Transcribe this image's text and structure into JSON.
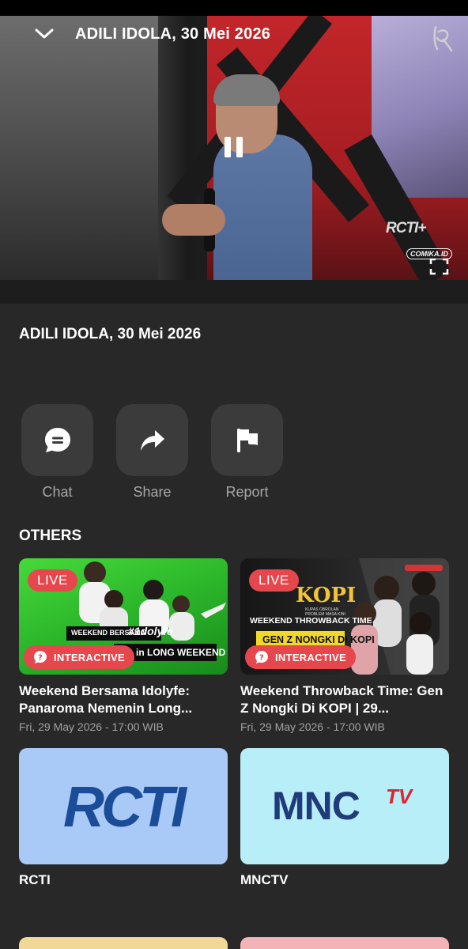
{
  "player": {
    "title": "ADILI IDOLA, 30 Mei 2026",
    "channel_bug": "RCTI+",
    "watermark": "COMIKA.ID"
  },
  "video": {
    "title": "ADILI IDOLA, 30 Mei 2026"
  },
  "actions": [
    {
      "label": "Chat",
      "icon": "chat-bubble-icon"
    },
    {
      "label": "Share",
      "icon": "share-arrow-icon"
    },
    {
      "label": "Report",
      "icon": "flag-icon"
    }
  ],
  "others": {
    "heading": "OTHERS",
    "items": [
      {
        "title": "Weekend Bersama Idolyfe: Panaroma Nemenin Long...",
        "date": "Fri, 29 May 2026 - 17:00 WIB",
        "live_label": "LIVE",
        "interactive_label": "INTERACTIVE",
        "thumb_text_top": "WEEKEND BERSAMA",
        "thumb_tag": "#1dolyfe",
        "thumb_text_bottom": "in LONG WEEKEND"
      },
      {
        "title": "Weekend Throwback Time: Gen Z Nongki Di KOPI | 29...",
        "date": "Fri, 29 May 2026 - 17:00 WIB",
        "live_label": "LIVE",
        "interactive_label": "INTERACTIVE",
        "thumb_brand": "KOPI",
        "thumb_brand_sub": "KUPAS OBROLAN PROBLEM MASA KINI",
        "thumb_text_top": "WEEKEND THROWBACK TIME",
        "thumb_text_bottom": "GEN Z NONGKI DI KOPI"
      }
    ]
  },
  "channels": [
    {
      "name": "RCTI",
      "logo_text": "RCTI",
      "bg": "#a9c9f6",
      "logo_color": "#1b4c98"
    },
    {
      "name": "MNCTV",
      "logo_text": "MNC",
      "logo_sup": "TV",
      "bg": "#b8eef8",
      "logo_color": "#1f3b7a",
      "sup_color": "#e0232c"
    }
  ],
  "colors": {
    "background": "#282828",
    "live_badge": "#e6474c",
    "button_bg": "#3b3b3b",
    "muted_text": "#a7a7a7"
  }
}
